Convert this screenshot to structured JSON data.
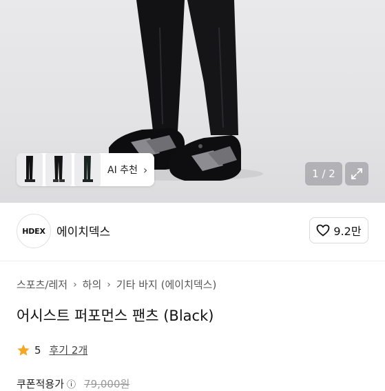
{
  "gallery": {
    "ai_recommend_label": "AI 추천",
    "counter_text": "1 / 2"
  },
  "brand": {
    "logo_text": "HDEX",
    "name": "에이치덱스",
    "likes": "9.2만"
  },
  "breadcrumb": [
    "스포츠/레저",
    "하의",
    "기타 바지 (에이치덱스)"
  ],
  "product": {
    "title": "어시스트 퍼포먼스 팬츠 (Black)",
    "rating": "5",
    "reviews": "후기 2개",
    "coupon_label": "쿠폰적용가",
    "original_price": "79,000원"
  },
  "colors": {
    "accent_star": "#f5a623",
    "text": "#111111"
  }
}
